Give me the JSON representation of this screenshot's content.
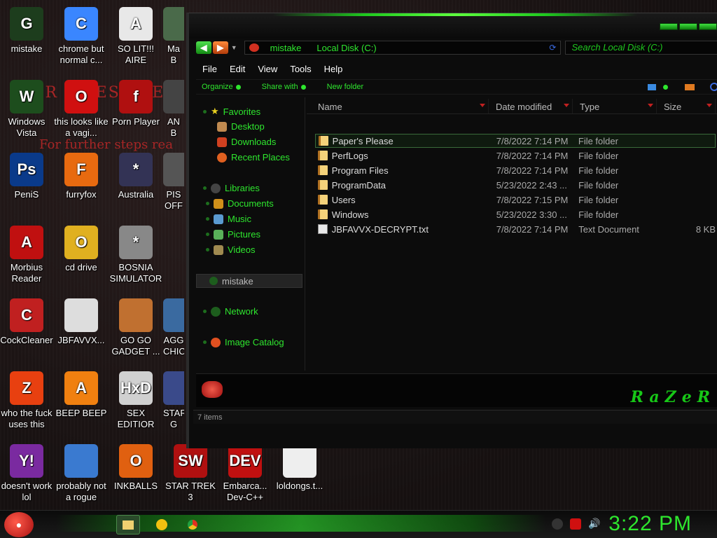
{
  "desktop": {
    "icons": [
      {
        "label": "mistake",
        "color": "#1d3d1d",
        "glyph": "G"
      },
      {
        "label": "chrome but normal c...",
        "color": "#3a86ff",
        "glyph": "C"
      },
      {
        "label": "SO LIT!!!\nAIRE",
        "color": "#e8e8e8",
        "glyph": "A"
      },
      {
        "label": "Ma\nB",
        "color": "#4a6a4a",
        "glyph": ""
      },
      {
        "label": "Windows Vista",
        "color": "#1d4d1d",
        "glyph": "W"
      },
      {
        "label": "this looks like a vagi...",
        "color": "#d01010",
        "glyph": "O"
      },
      {
        "label": "Porn Player",
        "color": "#b01010",
        "glyph": "f"
      },
      {
        "label": "AN\nB",
        "color": "#444",
        "glyph": ""
      },
      {
        "label": "PeniS",
        "color": "#0a3a8a",
        "glyph": "Ps"
      },
      {
        "label": "furryfox",
        "color": "#e86a10",
        "glyph": "F"
      },
      {
        "label": "Australia",
        "color": "#333355",
        "glyph": "*"
      },
      {
        "label": "PIS\nOFF",
        "color": "#555",
        "glyph": ""
      },
      {
        "label": "Morbius Reader",
        "color": "#c01010",
        "glyph": "A"
      },
      {
        "label": "cd drive",
        "color": "#e0b020",
        "glyph": "O"
      },
      {
        "label": "BOSNIA SIMULATOR",
        "color": "#888",
        "glyph": "*"
      },
      {
        "label": "CockCleaner",
        "color": "#c02020",
        "glyph": "C"
      },
      {
        "label": "JBFAVVX...",
        "color": "#dddddd",
        "glyph": ""
      },
      {
        "label": "GO GO GADGET ...",
        "color": "#c07030",
        "glyph": ""
      },
      {
        "label": "AGG\nCHIC",
        "color": "#3a6aa0",
        "glyph": ""
      },
      {
        "label": "who the fuck uses this",
        "color": "#e84010",
        "glyph": "Z"
      },
      {
        "label": "BEEP BEEP",
        "color": "#f08010",
        "glyph": "A"
      },
      {
        "label": "SEX EDITIOR",
        "color": "#d0d0d0",
        "glyph": "HxD"
      },
      {
        "label": "STAR\nG",
        "color": "#3a4a8a",
        "glyph": ""
      },
      {
        "label": "doesn't work lol",
        "color": "#7a2aa0",
        "glyph": "Y!"
      },
      {
        "label": "probably not a rogue",
        "color": "#3a7ad0",
        "glyph": ""
      },
      {
        "label": "INKBALLS",
        "color": "#e06010",
        "glyph": "O"
      },
      {
        "label": "STAR TREK 3",
        "color": "#b01010",
        "glyph": "SW"
      },
      {
        "label": "Embarca... Dev-C++",
        "color": "#c01010",
        "glyph": "DEV"
      },
      {
        "label": "loldongs.t...",
        "color": "#eeeeee",
        "glyph": ""
      }
    ],
    "overlay_line1": "UR FILES ARE UN",
    "overlay_line2": "For further steps rea"
  },
  "explorer": {
    "address": {
      "crumb_user": "mistake",
      "crumb_disk": "Local Disk (C:)"
    },
    "search_placeholder": "Search Local Disk (C:)",
    "menu": [
      "File",
      "Edit",
      "View",
      "Tools",
      "Help"
    ],
    "toolbar": {
      "organize": "Organize",
      "share_with": "Share with",
      "new_folder": "New folder"
    },
    "nav": {
      "favorites": "Favorites",
      "desktop": "Desktop",
      "downloads": "Downloads",
      "recent_places": "Recent Places",
      "libraries": "Libraries",
      "documents": "Documents",
      "music": "Music",
      "pictures": "Pictures",
      "videos": "Videos",
      "computer": "mistake",
      "network": "Network",
      "image_catalog": "Image Catalog"
    },
    "columns": {
      "name": "Name",
      "date_modified": "Date modified",
      "type": "Type",
      "size": "Size"
    },
    "files": [
      {
        "name": "Paper's Please",
        "date": "7/8/2022 7:14 PM",
        "type": "File folder",
        "size": "",
        "kind": "folder"
      },
      {
        "name": "PerfLogs",
        "date": "7/8/2022 7:14 PM",
        "type": "File folder",
        "size": "",
        "kind": "folder"
      },
      {
        "name": "Program Files",
        "date": "7/8/2022 7:14 PM",
        "type": "File folder",
        "size": "",
        "kind": "folder"
      },
      {
        "name": "ProgramData",
        "date": "5/23/2022 2:43 ...",
        "type": "File folder",
        "size": "",
        "kind": "folder"
      },
      {
        "name": "Users",
        "date": "7/8/2022 7:15 PM",
        "type": "File folder",
        "size": "",
        "kind": "folder"
      },
      {
        "name": "Windows",
        "date": "5/23/2022 3:30 ...",
        "type": "File folder",
        "size": "",
        "kind": "folder"
      },
      {
        "name": "JBFAVVX-DECRYPT.txt",
        "date": "7/8/2022 7:14 PM",
        "type": "Text Document",
        "size": "8 KB",
        "kind": "txt"
      }
    ],
    "logo_text": "RaZeR",
    "status": "7 items"
  },
  "taskbar": {
    "clock": "3:22 PM"
  },
  "colors": {
    "accent": "#2ee62e",
    "bg": "#0c0c0c"
  }
}
